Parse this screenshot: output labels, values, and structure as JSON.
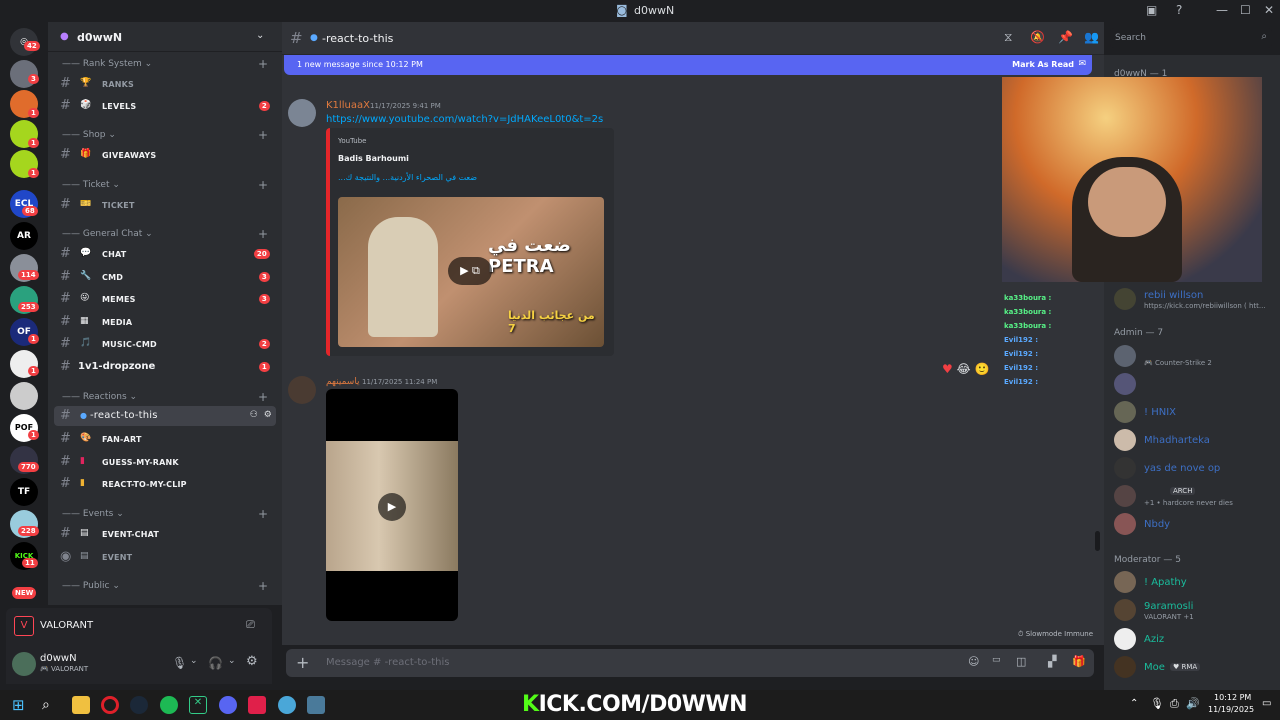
{
  "window": {
    "title": "d0wwN"
  },
  "servers": [
    {
      "badge": "42"
    },
    {
      "badge": "3"
    },
    {
      "badge": "1"
    },
    {
      "badge": "1"
    },
    {
      "badge": "1"
    },
    {
      "label": "ECL",
      "badge": "68"
    },
    {
      "label": "AR"
    },
    {
      "badge": "114"
    },
    {
      "badge": "253"
    },
    {
      "label": "OF",
      "badge": "1"
    },
    {
      "badge": "1"
    },
    {
      "badge": ""
    },
    {
      "label": "POF",
      "badge": "1"
    },
    {
      "badge": "770"
    },
    {
      "label": "TF"
    },
    {
      "badge": "228"
    },
    {
      "label": "KICK",
      "badge": "11"
    },
    {
      "badge": "NEW"
    }
  ],
  "guild": {
    "name": "d0wwN"
  },
  "categories": {
    "rank": "Rank System",
    "shop": "Shop",
    "ticket": "Ticket",
    "general": "General Chat",
    "reactions": "Reactions",
    "events": "Events",
    "public": "Public"
  },
  "channels": {
    "ranks": "RANKS",
    "levels": "LEVELS",
    "levels_count": "2",
    "giveaways": "GIVEAWAYS",
    "ticket": "TICKET",
    "chat": "CHAT",
    "chat_count": "20",
    "cmd": "CMD",
    "cmd_count": "3",
    "memes": "MEMES",
    "memes_count": "3",
    "media": "MEDIA",
    "music": "MUSIC-CMD",
    "music_count": "2",
    "dropzone": "1v1-dropzone",
    "dropzone_count": "1",
    "react": "-react-to-this",
    "fanart": "FAN-ART",
    "guess": "GUESS-MY-RANK",
    "clip": "REACT-TO-MY-CLIP",
    "eventchat": "EVENT-CHAT",
    "event": "EVENT"
  },
  "activity": {
    "game": "VALORANT"
  },
  "user": {
    "name": "d0wwN",
    "status": "VALORANT"
  },
  "header": {
    "channel": "-react-to-this",
    "search_placeholder": "Search"
  },
  "banner": {
    "text": "1 new message since 10:12 PM",
    "action": "Mark As Read"
  },
  "messages": [
    {
      "author": "K1lluaaX",
      "time": "11/17/2025 9:41 PM",
      "link": "https://www.youtube.com/watch?v=JdHAKeeL0t0&t=2s",
      "embed_provider": "YouTube",
      "embed_author": "Badis Barhoumi",
      "embed_title": "ضعت في الصحراء الأردنية... والنتيجة ك...",
      "thumb_text": "ضعت في PETRA",
      "thumb_sub": "من عجائب الدنيا 7"
    },
    {
      "author": "ياسمينهم",
      "time": "11/17/2025 11:24 PM"
    }
  ],
  "stream_chat": [
    {
      "name": "ka33boura :",
      "color": "#57f287"
    },
    {
      "name": "ka33boura :",
      "color": "#57f287"
    },
    {
      "name": "ka33boura :",
      "color": "#57f287"
    },
    {
      "name": "Evil192 :",
      "color": "#5aa9ff"
    },
    {
      "name": "Evil192 :",
      "color": "#5aa9ff"
    },
    {
      "name": "Evil192 :",
      "color": "#5aa9ff"
    },
    {
      "name": "Evil192 :",
      "color": "#5aa9ff"
    }
  ],
  "composer": {
    "placeholder": "Message # -react-to-this",
    "slowmode": "Slowmode Immune"
  },
  "members": {
    "group_owner": "d0wwN — 1",
    "streamer": "rebii willson",
    "streamer_status": "https://kick.com/rebiiwillson ( htt...",
    "group_admin": "Admin — 7",
    "admins": [
      {
        "name": "",
        "status": "Counter-Strike 2"
      },
      {
        "name": "",
        "status": ""
      },
      {
        "name": "! HNIX",
        "status": ""
      },
      {
        "name": "Mhadharteka",
        "status": ""
      },
      {
        "name": "yas de nove op",
        "status": ""
      },
      {
        "name": "ARCH",
        "status": "+1 • hardcore never dies"
      },
      {
        "name": "Nbdy",
        "status": ""
      }
    ],
    "group_mod": "Moderator — 5",
    "mods": [
      {
        "name": "! Apathy",
        "status": ""
      },
      {
        "name": "9aramosli",
        "status": "VALORANT +1"
      },
      {
        "name": "Aziz",
        "status": ""
      },
      {
        "name": "Moe",
        "tag": "RMA"
      }
    ]
  },
  "overlay": {
    "brand_prefix": "K",
    "brand": "ICK.COM/D0WWN"
  },
  "clock": {
    "time": "10:12 PM",
    "date": "11/19/2025"
  }
}
